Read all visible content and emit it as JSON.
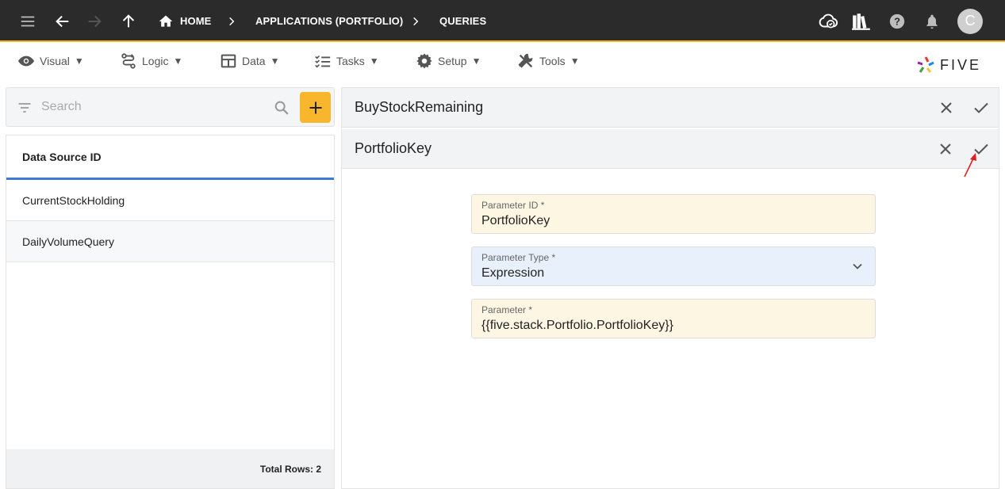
{
  "topbar": {
    "breadcrumbs": [
      "HOME",
      "APPLICATIONS (PORTFOLIO)",
      "QUERIES"
    ],
    "avatar_letter": "C",
    "icons": [
      "menu-icon",
      "back-arrow-icon",
      "forward-arrow-icon",
      "up-arrow-icon",
      "home-icon",
      "cloud-check-icon",
      "library-icon",
      "help-icon",
      "bell-icon"
    ]
  },
  "menubar": {
    "items": [
      {
        "label": "Visual",
        "icon": "eye-icon"
      },
      {
        "label": "Logic",
        "icon": "logic-icon"
      },
      {
        "label": "Data",
        "icon": "table-icon"
      },
      {
        "label": "Tasks",
        "icon": "checklist-icon"
      },
      {
        "label": "Setup",
        "icon": "gear-icon"
      },
      {
        "label": "Tools",
        "icon": "tools-icon"
      }
    ],
    "caret": "▼",
    "logo_text": "FIVE"
  },
  "search": {
    "placeholder": "Search"
  },
  "list": {
    "header": "Data Source ID",
    "rows": [
      "CurrentStockHolding",
      "DailyVolumeQuery"
    ],
    "footer": "Total Rows: 2"
  },
  "forms": {
    "parent_title": "BuyStockRemaining",
    "child_title": "PortfolioKey"
  },
  "fields": [
    {
      "label": "Parameter ID *",
      "value": "PortfolioKey"
    },
    {
      "label": "Parameter Type *",
      "value": "Expression"
    },
    {
      "label": "Parameter *",
      "value": "{{five.stack.Portfolio.PortfolioKey}}"
    }
  ],
  "colors": {
    "topbar_bg": "#2b2b2b",
    "accent": "#f5b324",
    "selected_underline": "#3c7bd1",
    "field_yellow": "#fdf6e3",
    "field_blue": "#e7f0fb",
    "annotation_arrow": "#e02020"
  }
}
